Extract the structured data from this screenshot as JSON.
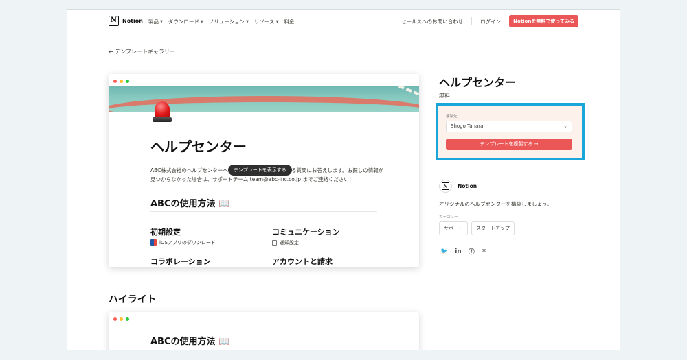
{
  "nav": {
    "logo_text": "Notion",
    "logo_glyph": "N",
    "menu": [
      {
        "label": "製品",
        "has_caret": true
      },
      {
        "label": "ダウンロード",
        "has_caret": true
      },
      {
        "label": "ソリューション",
        "has_caret": true
      },
      {
        "label": "リソース",
        "has_caret": true
      },
      {
        "label": "料金",
        "has_caret": false
      }
    ],
    "contact_sales": "セールスへのお問い合わせ",
    "login": "ログイン",
    "cta": "Notionを無料で使ってみる"
  },
  "back_link": "← テンプレートギャラリー",
  "preview": {
    "title": "ヘルプセンター",
    "description": "ABC株式会社のヘルプセンターへ ようこそ！こちらでよくある質問にお答えします。お探しの情報が見つからなかった場合は、サポートチーム team@abc-inc.co.jp までご連絡ください！",
    "tooltip": "テンプレートを表示する",
    "section_heading": "ABCの使用方法 📖",
    "categories": [
      {
        "title": "初期設定",
        "item": "iOSアプリのダウンロード"
      },
      {
        "title": "コミュニケーション",
        "item": "通知設定"
      },
      {
        "title": "コラボレーション"
      },
      {
        "title": "アカウントと請求"
      }
    ]
  },
  "highlight": {
    "heading": "ハイライト",
    "card_title": "ABCの使用方法 📖"
  },
  "sidebar": {
    "title": "ヘルプセンター",
    "price": "無料",
    "duplicate_label": "複製先",
    "workspace": "Shogo Tahara",
    "duplicate_button": "テンプレートを複製する →",
    "author": "Notion",
    "description": "オリジナルのヘルプセンターを構築しましょう。",
    "category_label": "カテゴリー",
    "tags": [
      "サポート",
      "スタートアップ"
    ],
    "share_icons": [
      "twitter-icon",
      "linkedin-icon",
      "facebook-icon",
      "mail-icon"
    ]
  },
  "colors": {
    "accent_red": "#eb5757",
    "highlight_box": "#1aa6d8"
  }
}
